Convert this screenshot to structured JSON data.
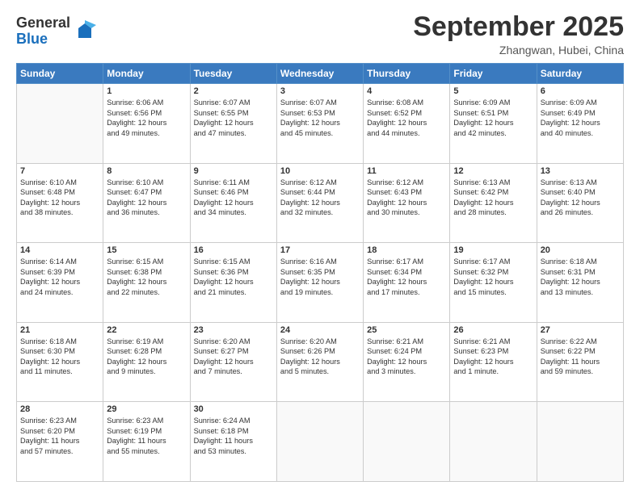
{
  "header": {
    "logo_general": "General",
    "logo_blue": "Blue",
    "title": "September 2025",
    "location": "Zhangwan, Hubei, China"
  },
  "weekdays": [
    "Sunday",
    "Monday",
    "Tuesday",
    "Wednesday",
    "Thursday",
    "Friday",
    "Saturday"
  ],
  "weeks": [
    [
      {
        "day": "",
        "info": ""
      },
      {
        "day": "1",
        "info": "Sunrise: 6:06 AM\nSunset: 6:56 PM\nDaylight: 12 hours\nand 49 minutes."
      },
      {
        "day": "2",
        "info": "Sunrise: 6:07 AM\nSunset: 6:55 PM\nDaylight: 12 hours\nand 47 minutes."
      },
      {
        "day": "3",
        "info": "Sunrise: 6:07 AM\nSunset: 6:53 PM\nDaylight: 12 hours\nand 45 minutes."
      },
      {
        "day": "4",
        "info": "Sunrise: 6:08 AM\nSunset: 6:52 PM\nDaylight: 12 hours\nand 44 minutes."
      },
      {
        "day": "5",
        "info": "Sunrise: 6:09 AM\nSunset: 6:51 PM\nDaylight: 12 hours\nand 42 minutes."
      },
      {
        "day": "6",
        "info": "Sunrise: 6:09 AM\nSunset: 6:49 PM\nDaylight: 12 hours\nand 40 minutes."
      }
    ],
    [
      {
        "day": "7",
        "info": "Sunrise: 6:10 AM\nSunset: 6:48 PM\nDaylight: 12 hours\nand 38 minutes."
      },
      {
        "day": "8",
        "info": "Sunrise: 6:10 AM\nSunset: 6:47 PM\nDaylight: 12 hours\nand 36 minutes."
      },
      {
        "day": "9",
        "info": "Sunrise: 6:11 AM\nSunset: 6:46 PM\nDaylight: 12 hours\nand 34 minutes."
      },
      {
        "day": "10",
        "info": "Sunrise: 6:12 AM\nSunset: 6:44 PM\nDaylight: 12 hours\nand 32 minutes."
      },
      {
        "day": "11",
        "info": "Sunrise: 6:12 AM\nSunset: 6:43 PM\nDaylight: 12 hours\nand 30 minutes."
      },
      {
        "day": "12",
        "info": "Sunrise: 6:13 AM\nSunset: 6:42 PM\nDaylight: 12 hours\nand 28 minutes."
      },
      {
        "day": "13",
        "info": "Sunrise: 6:13 AM\nSunset: 6:40 PM\nDaylight: 12 hours\nand 26 minutes."
      }
    ],
    [
      {
        "day": "14",
        "info": "Sunrise: 6:14 AM\nSunset: 6:39 PM\nDaylight: 12 hours\nand 24 minutes."
      },
      {
        "day": "15",
        "info": "Sunrise: 6:15 AM\nSunset: 6:38 PM\nDaylight: 12 hours\nand 22 minutes."
      },
      {
        "day": "16",
        "info": "Sunrise: 6:15 AM\nSunset: 6:36 PM\nDaylight: 12 hours\nand 21 minutes."
      },
      {
        "day": "17",
        "info": "Sunrise: 6:16 AM\nSunset: 6:35 PM\nDaylight: 12 hours\nand 19 minutes."
      },
      {
        "day": "18",
        "info": "Sunrise: 6:17 AM\nSunset: 6:34 PM\nDaylight: 12 hours\nand 17 minutes."
      },
      {
        "day": "19",
        "info": "Sunrise: 6:17 AM\nSunset: 6:32 PM\nDaylight: 12 hours\nand 15 minutes."
      },
      {
        "day": "20",
        "info": "Sunrise: 6:18 AM\nSunset: 6:31 PM\nDaylight: 12 hours\nand 13 minutes."
      }
    ],
    [
      {
        "day": "21",
        "info": "Sunrise: 6:18 AM\nSunset: 6:30 PM\nDaylight: 12 hours\nand 11 minutes."
      },
      {
        "day": "22",
        "info": "Sunrise: 6:19 AM\nSunset: 6:28 PM\nDaylight: 12 hours\nand 9 minutes."
      },
      {
        "day": "23",
        "info": "Sunrise: 6:20 AM\nSunset: 6:27 PM\nDaylight: 12 hours\nand 7 minutes."
      },
      {
        "day": "24",
        "info": "Sunrise: 6:20 AM\nSunset: 6:26 PM\nDaylight: 12 hours\nand 5 minutes."
      },
      {
        "day": "25",
        "info": "Sunrise: 6:21 AM\nSunset: 6:24 PM\nDaylight: 12 hours\nand 3 minutes."
      },
      {
        "day": "26",
        "info": "Sunrise: 6:21 AM\nSunset: 6:23 PM\nDaylight: 12 hours\nand 1 minute."
      },
      {
        "day": "27",
        "info": "Sunrise: 6:22 AM\nSunset: 6:22 PM\nDaylight: 11 hours\nand 59 minutes."
      }
    ],
    [
      {
        "day": "28",
        "info": "Sunrise: 6:23 AM\nSunset: 6:20 PM\nDaylight: 11 hours\nand 57 minutes."
      },
      {
        "day": "29",
        "info": "Sunrise: 6:23 AM\nSunset: 6:19 PM\nDaylight: 11 hours\nand 55 minutes."
      },
      {
        "day": "30",
        "info": "Sunrise: 6:24 AM\nSunset: 6:18 PM\nDaylight: 11 hours\nand 53 minutes."
      },
      {
        "day": "",
        "info": ""
      },
      {
        "day": "",
        "info": ""
      },
      {
        "day": "",
        "info": ""
      },
      {
        "day": "",
        "info": ""
      }
    ]
  ]
}
